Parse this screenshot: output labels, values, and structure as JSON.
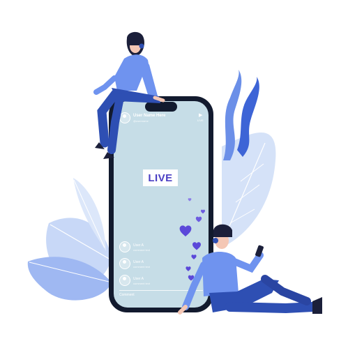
{
  "stream": {
    "host_name": "User Name Here",
    "host_sub": "@username",
    "status_icon": "play-icon",
    "status_label": "LIVE",
    "badge_label": "LIVE"
  },
  "comments": [
    {
      "name": "User A",
      "text": "comment text"
    },
    {
      "name": "User A",
      "text": "comment text"
    },
    {
      "name": "User A",
      "text": "comment text"
    }
  ],
  "comment_field_placeholder": "Comment",
  "colors": {
    "accent": "#4b3fc4",
    "heart": "#5b48d9",
    "leaf_light": "#c8d8f7",
    "leaf_blue": "#6b8fe8",
    "shirt": "#6f93ef",
    "pants": "#2e4fb3",
    "screen": "#c6dde7",
    "phone": "#121a2e"
  }
}
